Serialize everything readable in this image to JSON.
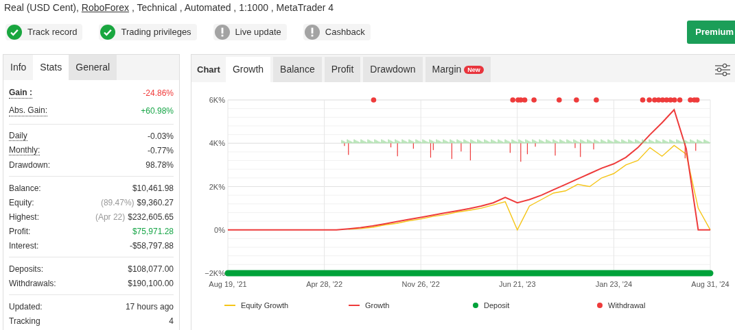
{
  "account": {
    "prefix": "Real (USD Cent),",
    "broker_link": "RoboForex",
    "suffix": ", Technical , Automated , 1:1000 , MetaTrader 4"
  },
  "badges": [
    {
      "label": "Track record",
      "verified": true
    },
    {
      "label": "Trading privileges",
      "verified": true
    },
    {
      "label": "Live update",
      "verified": false
    },
    {
      "label": "Cashback",
      "verified": false
    }
  ],
  "premium_button": "Premium",
  "stats_panel": {
    "title": "Info",
    "tabs": [
      {
        "label": "Stats",
        "selected": true
      },
      {
        "label": "General",
        "selected": false
      }
    ],
    "groups": [
      [
        {
          "label": "Gain :",
          "value": "-24.86%",
          "color": "#f03a3a",
          "has_tooltip": true,
          "emphasized": true
        },
        {
          "label": "Abs. Gain:",
          "value": "+60.98%",
          "color": "#17a547",
          "has_tooltip": true,
          "emphasized": false
        }
      ],
      [
        {
          "label": "Daily",
          "value": "-0.03%",
          "color": "#333333",
          "has_tooltip": true,
          "emphasized": false
        },
        {
          "label": "Monthly:",
          "value": "-0.77%",
          "color": "#333333",
          "has_tooltip": true,
          "emphasized": false
        },
        {
          "label": "Drawdown:",
          "value": "98.78%",
          "color": "#333333",
          "has_tooltip": false,
          "emphasized": false
        }
      ],
      [
        {
          "label": "Balance:",
          "value": "$10,461.98",
          "color": "#333333",
          "has_tooltip": false,
          "emphasized": false
        },
        {
          "label": "Equity:",
          "note": "(89.47%)",
          "value": "$9,360.27",
          "color": "#333333",
          "has_tooltip": false,
          "emphasized": false
        },
        {
          "label": "Highest:",
          "note": "(Apr 22)",
          "value": "$232,605.65",
          "color": "#333333",
          "has_tooltip": false,
          "emphasized": false
        },
        {
          "label": "Profit:",
          "value": "$75,971.28",
          "color": "#17a547",
          "has_tooltip": false,
          "emphasized": false
        },
        {
          "label": "Interest:",
          "value": "-$58,797.88",
          "color": "#333333",
          "has_tooltip": false,
          "emphasized": false
        }
      ],
      [
        {
          "label": "Deposits:",
          "value": "$108,077.00",
          "color": "#333333",
          "has_tooltip": false,
          "emphasized": false
        },
        {
          "label": "Withdrawals:",
          "value": "$190,100.00",
          "color": "#333333",
          "has_tooltip": false,
          "emphasized": false
        }
      ],
      [
        {
          "label": "Updated:",
          "value": "17 hours ago",
          "color": "#333333",
          "has_tooltip": false,
          "emphasized": false
        },
        {
          "label": "Tracking",
          "value": "4",
          "color": "#333333",
          "has_tooltip": false,
          "emphasized": false
        }
      ]
    ]
  },
  "chart_panel": {
    "title": "Chart",
    "tabs": [
      {
        "label": "Growth",
        "selected": true
      },
      {
        "label": "Balance",
        "selected": false
      },
      {
        "label": "Profit",
        "selected": false
      },
      {
        "label": "Drawdown",
        "selected": false
      },
      {
        "label": "Margin",
        "selected": false,
        "badge": "New"
      }
    ],
    "chart_data": {
      "type": "line",
      "categories": [
        "Aug 19, '21",
        null,
        null,
        null,
        null,
        null,
        null,
        null,
        "Apr 28, '22",
        null,
        null,
        null,
        null,
        null,
        null,
        null,
        "Nov 26, '22",
        null,
        null,
        null,
        null,
        null,
        null,
        null,
        "Jun 21, '23",
        null,
        null,
        null,
        null,
        null,
        null,
        null,
        "Jan 23, '24",
        null,
        null,
        null,
        null,
        null,
        null,
        null,
        "Aug 31, '24"
      ],
      "ylim": [
        -2000,
        6000
      ],
      "grid": true,
      "yticks": [
        {
          "value": 6000,
          "label": "6K%"
        },
        {
          "value": 4000,
          "label": "4K%"
        },
        {
          "value": 2000,
          "label": "2K%"
        },
        {
          "value": 0,
          "label": "0%"
        },
        {
          "value": -2000,
          "label": "−2K%"
        }
      ],
      "series": [
        {
          "name": "Equity Growth",
          "color": "#f5c518",
          "values": [
            null,
            null,
            null,
            null,
            null,
            null,
            null,
            null,
            null,
            null,
            30,
            60,
            120,
            230,
            300,
            420,
            500,
            620,
            700,
            820,
            900,
            1000,
            1150,
            1300,
            0,
            1100,
            1400,
            1700,
            1800,
            2100,
            2000,
            2400,
            2600,
            3000,
            3200,
            3800,
            3400,
            3900,
            3500,
            1000,
            0
          ]
        },
        {
          "name": "Growth",
          "color": "#ee3b3b",
          "values": [
            0,
            0,
            0,
            0,
            0,
            0,
            0,
            0,
            0,
            0,
            50,
            100,
            180,
            280,
            380,
            480,
            580,
            680,
            780,
            880,
            980,
            1100,
            1250,
            1500,
            1250,
            1400,
            1600,
            1850,
            2100,
            2350,
            2600,
            2850,
            3050,
            3350,
            3800,
            4400,
            4950,
            5550,
            3750,
            0,
            0
          ]
        }
      ]
    },
    "markers": [
      {
        "label": "Deposit",
        "color": "#00a23a"
      },
      {
        "label": "Withdrawal",
        "color": "#ee3b3b"
      }
    ]
  }
}
